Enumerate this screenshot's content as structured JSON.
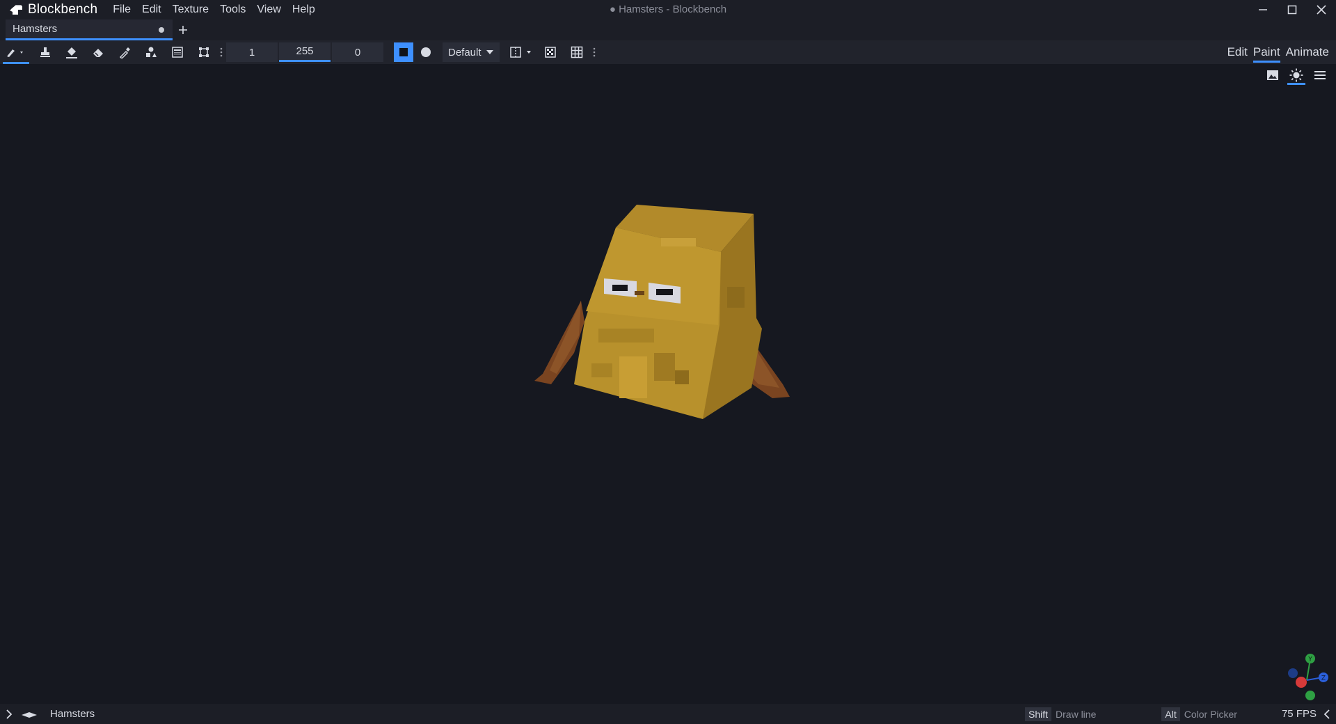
{
  "app": {
    "name": "Blockbench",
    "window_title": "● Hamsters - Blockbench"
  },
  "menu": {
    "items": [
      "File",
      "Edit",
      "Texture",
      "Tools",
      "View",
      "Help"
    ]
  },
  "tabs": [
    {
      "label": "Hamsters",
      "unsaved": true
    }
  ],
  "toolbar": {
    "tools": [
      "brush-icon",
      "stamp-icon",
      "fill-bucket-icon",
      "eraser-icon",
      "color-picker-icon",
      "shapes-icon",
      "gradient-icon",
      "selection-icon"
    ],
    "brush_size": "1",
    "opacity": "255",
    "softness": "0",
    "brush_shape_selected": "square",
    "blend_mode": "Default"
  },
  "modes": {
    "edit": "Edit",
    "paint": "Paint",
    "animate": "Animate",
    "active": "Paint"
  },
  "viewport": {
    "model_name": "Hamsters",
    "colors": {
      "fur": "#b8912c",
      "fur_dark": "#8d6b1c",
      "ears": "#7a4420",
      "background": "#161820"
    }
  },
  "statusbar": {
    "project": "Hamsters",
    "shortcut1_key": "Shift",
    "shortcut1_hint": "Draw line",
    "shortcut2_key": "Alt",
    "shortcut2_hint": "Color Picker",
    "fps": "75 FPS"
  },
  "theme": {
    "accent": "#3e90ff"
  }
}
